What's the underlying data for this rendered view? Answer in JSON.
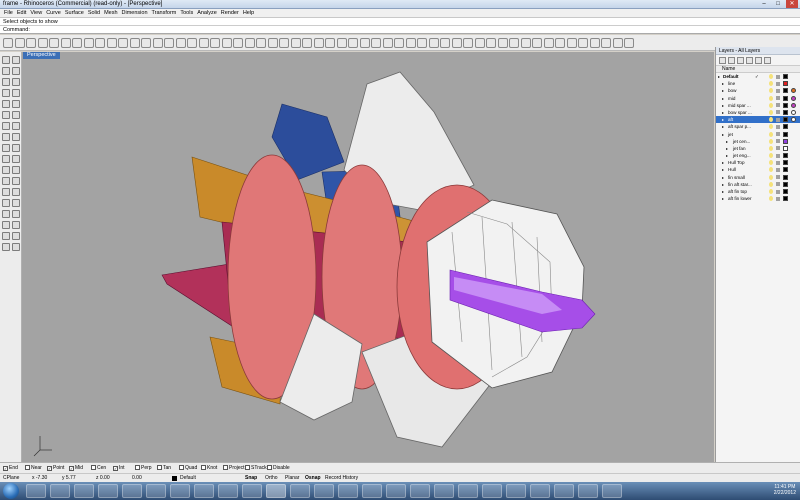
{
  "window": {
    "title": "frame - Rhinoceros (Commercial) (read-only) - [Perspective]"
  },
  "menu": [
    "File",
    "Edit",
    "View",
    "Curve",
    "Surface",
    "Solid",
    "Mesh",
    "Dimension",
    "Transform",
    "Tools",
    "Analyze",
    "Render",
    "Help"
  ],
  "command": {
    "history": "Select objects to show",
    "prompt": "Command:"
  },
  "viewport": {
    "tab": "Perspective"
  },
  "layers": {
    "title": "Layers - All Layers",
    "column": "Name",
    "items": [
      {
        "name": "Default",
        "check": "✓",
        "color": "#000000",
        "material": "",
        "indent": 0,
        "bold": true,
        "selected": false
      },
      {
        "name": "line",
        "check": "",
        "color": "#e02020",
        "material": "",
        "indent": 1,
        "bold": false,
        "selected": false
      },
      {
        "name": "bow",
        "check": "",
        "color": "#000000",
        "material": "#e07020",
        "indent": 1,
        "bold": false,
        "selected": false
      },
      {
        "name": "mid",
        "check": "",
        "color": "#000000",
        "material": "#c040c0",
        "indent": 1,
        "bold": false,
        "selected": false
      },
      {
        "name": "mid spar ...",
        "check": "",
        "color": "#000000",
        "material": "#c040c0",
        "indent": 1,
        "bold": false,
        "selected": false
      },
      {
        "name": "bow spar ...",
        "check": "",
        "color": "#000000",
        "material": "#ffffff",
        "indent": 1,
        "bold": false,
        "selected": false
      },
      {
        "name": "aft",
        "check": "",
        "color": "#000000",
        "material": "#ffffff",
        "indent": 1,
        "bold": false,
        "selected": true
      },
      {
        "name": "aft spar p...",
        "check": "",
        "color": "#000000",
        "material": "",
        "indent": 1,
        "bold": false,
        "selected": false
      },
      {
        "name": "jet",
        "check": "",
        "color": "#000000",
        "material": "",
        "indent": 1,
        "bold": false,
        "selected": false
      },
      {
        "name": "jet cen...",
        "check": "",
        "color": "#9040e0",
        "material": "",
        "indent": 2,
        "bold": false,
        "selected": false
      },
      {
        "name": "jet fan",
        "check": "",
        "color": "#ffffff",
        "material": "",
        "indent": 2,
        "bold": false,
        "selected": false
      },
      {
        "name": "jet eng...",
        "check": "",
        "color": "#000000",
        "material": "",
        "indent": 2,
        "bold": false,
        "selected": false
      },
      {
        "name": "Hull Top",
        "check": "",
        "color": "#000000",
        "material": "",
        "indent": 1,
        "bold": false,
        "selected": false
      },
      {
        "name": "Hull",
        "check": "",
        "color": "#000000",
        "material": "",
        "indent": 1,
        "bold": false,
        "selected": false
      },
      {
        "name": "fin small",
        "check": "",
        "color": "#000000",
        "material": "",
        "indent": 1,
        "bold": false,
        "selected": false
      },
      {
        "name": "fin aft star...",
        "check": "",
        "color": "#000000",
        "material": "",
        "indent": 1,
        "bold": false,
        "selected": false
      },
      {
        "name": "aft fin top",
        "check": "",
        "color": "#000000",
        "material": "",
        "indent": 1,
        "bold": false,
        "selected": false
      },
      {
        "name": "aft fin lower",
        "check": "",
        "color": "#000000",
        "material": "",
        "indent": 1,
        "bold": false,
        "selected": false
      }
    ]
  },
  "osnaps": [
    {
      "label": "End",
      "checked": true
    },
    {
      "label": "Near",
      "checked": false
    },
    {
      "label": "Point",
      "checked": true
    },
    {
      "label": "Mid",
      "checked": true
    },
    {
      "label": "Cen",
      "checked": false
    },
    {
      "label": "Int",
      "checked": true
    },
    {
      "label": "Perp",
      "checked": false
    },
    {
      "label": "Tan",
      "checked": false
    },
    {
      "label": "Quad",
      "checked": false
    },
    {
      "label": "Knot",
      "checked": false
    },
    {
      "label": "Project",
      "checked": false
    },
    {
      "label": "STrack",
      "checked": false
    },
    {
      "label": "Disable",
      "checked": false
    }
  ],
  "status": {
    "cplane": "CPlane",
    "x": "x -7.30",
    "y": "y 5.77",
    "z": "z 0.00",
    "dist": "0.00",
    "layer": "Default",
    "toggles": [
      "Snap",
      "Ortho",
      "Planar",
      "Osnap",
      "Record History"
    ]
  },
  "taskbar": {
    "time": "11:41 PM",
    "date": "2/22/2012"
  }
}
